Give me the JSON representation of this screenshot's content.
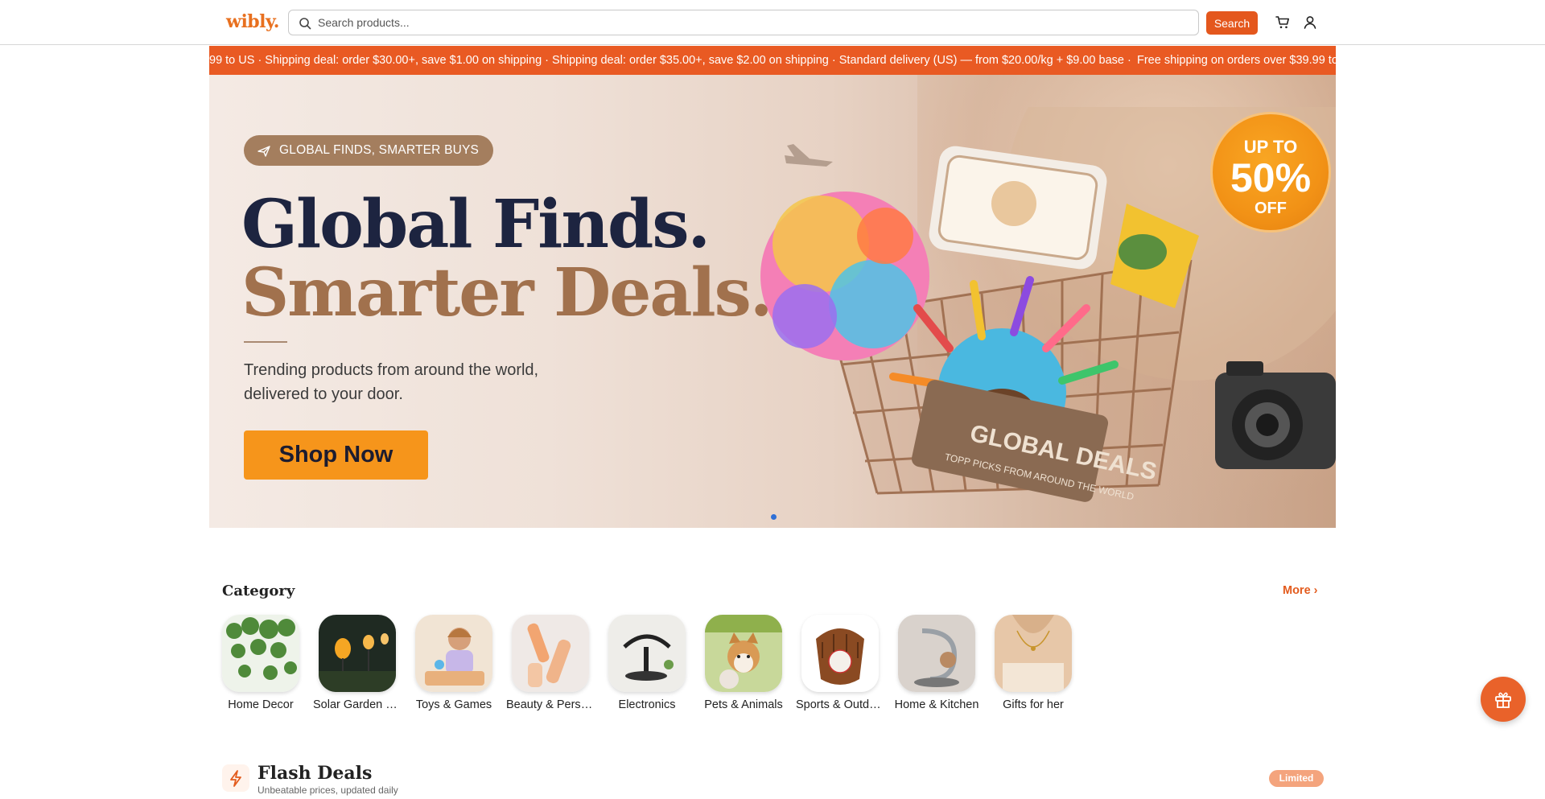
{
  "header": {
    "logo": "wibly.",
    "search_placeholder": "Search products...",
    "search_button": "Search",
    "icons": [
      "search-icon",
      "cart-icon",
      "user-icon"
    ]
  },
  "ticker": {
    "segments": [
      "99 to US · Shipping deal: order $30.00+, save $1.00 on shipping · Shipping deal: order $35.00+, save $2.00 on shipping · Standard delivery (US) — from $20.00/kg + $9.00 base ·",
      "Free shipping on orders over $39.99 to"
    ]
  },
  "hero": {
    "pill": "GLOBAL FINDS, SMARTER BUYS",
    "headline_1": "Global Finds.",
    "headline_2": "Smarter Deals.",
    "subtitle": "Trending products from around the world, delivered to your door.",
    "cta": "Shop Now",
    "badge_top": "UP TO",
    "badge_value": "50%",
    "badge_bottom": "OFF",
    "cart_sign": "GLOBAL DEALS",
    "cart_sign_sub": "TOPP PICKS FROM AROUND THE WORLD"
  },
  "category": {
    "title": "Category",
    "more": "More",
    "items": [
      {
        "label": "Home Decor"
      },
      {
        "label": "Solar Garden Lights"
      },
      {
        "label": "Toys & Games"
      },
      {
        "label": "Beauty & Personal Care"
      },
      {
        "label": "Electronics"
      },
      {
        "label": "Pets & Animals"
      },
      {
        "label": "Sports & Outdoors"
      },
      {
        "label": "Home & Kitchen"
      },
      {
        "label": "Gifts for her"
      }
    ]
  },
  "flash_deals": {
    "title": "Flash Deals",
    "subtitle": "Unbeatable prices, updated daily",
    "badge": "Limited"
  },
  "colors": {
    "brand": "#e8701f",
    "accent": "#e4571d",
    "cta": "#f6951b"
  }
}
